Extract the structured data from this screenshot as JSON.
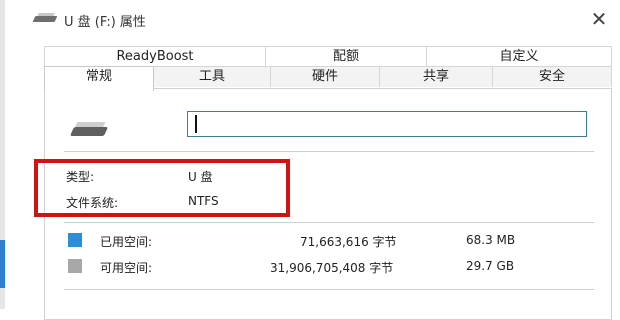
{
  "window": {
    "title": "U 盘 (F:) 属性",
    "close_symbol": "✕"
  },
  "tabs": {
    "row1": [
      "ReadyBoost",
      "配额",
      "自定义"
    ],
    "row2": [
      "常规",
      "工具",
      "硬件",
      "共享",
      "安全"
    ],
    "active": "常规"
  },
  "general": {
    "name_value": "",
    "type_label": "类型:",
    "type_value": "U 盘",
    "fs_label": "文件系统:",
    "fs_value": "NTFS"
  },
  "space": {
    "used": {
      "label": "已用空间:",
      "bytes": "71,663,616 字节",
      "size": "68.3 MB",
      "color": "#2a8fd6"
    },
    "free": {
      "label": "可用空间:",
      "bytes": "31,906,705,408 字节",
      "size": "29.7 GB",
      "color": "#a8a8a8"
    }
  },
  "colors": {
    "highlight": "#d01212",
    "input_border": "#3d7f8c"
  }
}
